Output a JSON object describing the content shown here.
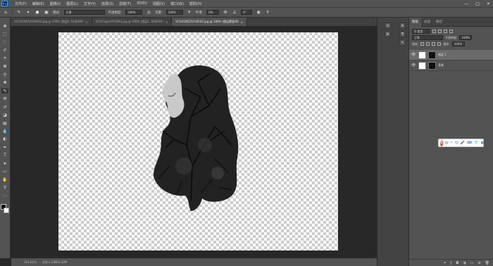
{
  "app": {
    "logo": "Ps"
  },
  "menubar": {
    "items": [
      "文件(F)",
      "编辑(E)",
      "图像(I)",
      "图层(L)",
      "文字(Y)",
      "选择(S)",
      "滤镜(T)",
      "3D(D)",
      "视图(V)",
      "窗口(W)",
      "帮助(H)"
    ],
    "controls": [
      "—",
      "□",
      "✕"
    ]
  },
  "options": {
    "mode_label": "模式:",
    "mode_value": "正常",
    "opacity_label": "不透明度:",
    "opacity_value": "100%",
    "flow_label": "流量:",
    "flow_value": "100%",
    "smooth_label": "平滑:",
    "smooth_value": "0%",
    "angle_value": "0°"
  },
  "tabs": [
    {
      "label": "VCG41N519194930.jpg @ 100% (图层0, RGB/8#)",
      "close": "×"
    },
    {
      "label": "VCG21gic9741993.jpg @ 100% (图层1, RGB/8#)",
      "close": "×"
    },
    {
      "label": "VCG41N525234542.jpg @ 100% (图层蒙版/8)",
      "close": "×"
    }
  ],
  "status": {
    "zoom": "101.61%",
    "doc": "文档:1.19M/3.32M"
  },
  "panel": {
    "tabs": [
      "图层",
      "通道",
      "路径"
    ],
    "kind_label": "Q 类型",
    "blend_mode": "正常",
    "opacity_label": "不透明度:",
    "opacity_value": "100%",
    "lock_label": "锁定:",
    "fill_label": "填充:",
    "fill_value": "100%",
    "layers": [
      {
        "name": "图层 1",
        "visible": "👁"
      },
      {
        "name": "背景",
        "visible": "👁"
      }
    ]
  },
  "ime": {
    "logo": "S",
    "buttons": [
      "中",
      "•",
      "☺",
      "🎤",
      "⌨",
      "👕",
      "▦"
    ]
  }
}
